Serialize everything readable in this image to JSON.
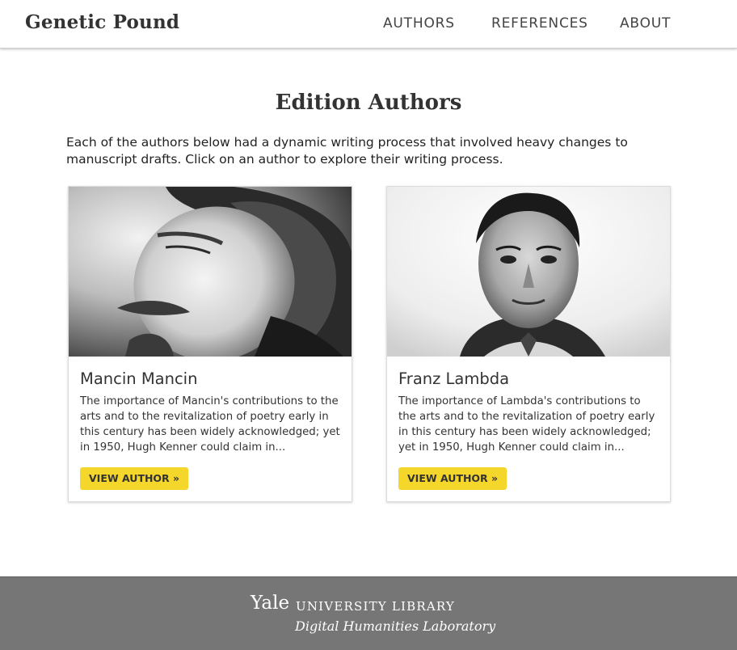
{
  "header": {
    "brand": "Genetic Pound",
    "nav": [
      {
        "label": "AUTHORS"
      },
      {
        "label": "REFERENCES"
      },
      {
        "label": "ABOUT"
      }
    ]
  },
  "main": {
    "title": "Edition Authors",
    "intro": "Each of the authors below had a dynamic writing process that involved heavy changes to manuscript drafts. Click on an author to explore their writing process.",
    "authors": [
      {
        "name": "Mancin Mancin",
        "description": "The importance of Mancin's contributions to the arts and to the revitalization of poetry early in this century has been widely acknowledged; yet in 1950, Hugh Kenner could claim in...",
        "button_label": "VIEW AUTHOR »"
      },
      {
        "name": "Franz Lambda",
        "description": "The importance of Lambda's contributions to the arts and to the revitalization of poetry early in this century has been widely acknowledged; yet in 1950, Hugh Kenner could claim in...",
        "button_label": "VIEW AUTHOR »"
      }
    ]
  },
  "footer": {
    "yale": "Yale",
    "library": "UNIVERSITY LIBRARY",
    "lab": "Digital Humanities Laboratory"
  },
  "colors": {
    "button_bg": "#f5d62a",
    "footer_bg": "#767676",
    "header_bg": "#ffffff"
  }
}
